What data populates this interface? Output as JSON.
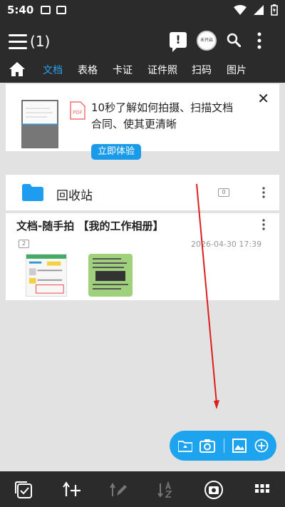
{
  "status_bar": {
    "time": "5:40"
  },
  "app_bar": {
    "count": "(1)",
    "avatar_text": "未开启",
    "tabs": [
      {
        "label": "文档",
        "active": true
      },
      {
        "label": "表格",
        "active": false
      },
      {
        "label": "卡证",
        "active": false
      },
      {
        "label": "证件照",
        "active": false
      },
      {
        "label": "扫码",
        "active": false
      },
      {
        "label": "图片",
        "active": false
      }
    ]
  },
  "banner": {
    "title_line1": "10秒了解如何拍摄、扫描文档",
    "title_line2": "合同、使其更清晰",
    "button": "立即体验",
    "pdf_label": "PDF"
  },
  "recycle": {
    "label": "回收站",
    "count": "0"
  },
  "album": {
    "title": "文档-随手拍 【我的工作相册】",
    "count": "2",
    "date": "2026-04-30 17:39"
  },
  "colors": {
    "accent": "#1ea4ef",
    "bar": "#2b2b2b",
    "annotation": "#dd1e1e"
  }
}
